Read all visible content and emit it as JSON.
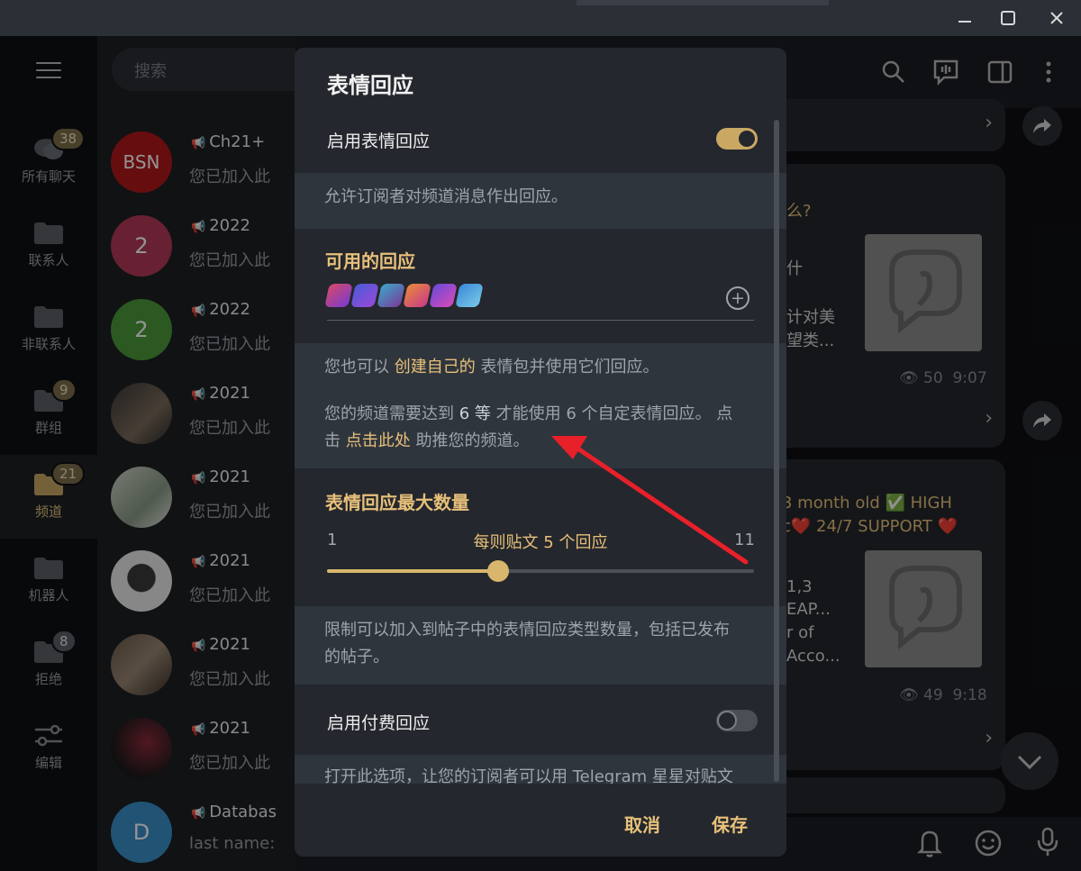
{
  "window": {
    "minimize": "—",
    "maximize": "☐",
    "close": "✕"
  },
  "rail": {
    "items": [
      {
        "label": "所有聊天",
        "badge": "38",
        "icon": "chats-icon"
      },
      {
        "label": "联系人",
        "badge": "",
        "icon": "folder-icon"
      },
      {
        "label": "非联系人",
        "badge": "",
        "icon": "folder-icon"
      },
      {
        "label": "群组",
        "badge": "9",
        "icon": "folder-icon"
      },
      {
        "label": "频道",
        "badge": "21",
        "icon": "folder-icon",
        "active": true
      },
      {
        "label": "机器人",
        "badge": "",
        "icon": "folder-icon"
      },
      {
        "label": "拒绝",
        "badge": "8",
        "icon": "folder-icon"
      },
      {
        "label": "编辑",
        "badge": "",
        "icon": "sliders-icon"
      }
    ]
  },
  "chatlist": {
    "search_placeholder": "搜索",
    "chats": [
      {
        "avatar": "BSN",
        "name": "Ch21+",
        "preview": "您已加入此"
      },
      {
        "avatar": "2",
        "name": "2022",
        "preview": "您已加入此"
      },
      {
        "avatar": "2",
        "name": "2022",
        "preview": "您已加入此"
      },
      {
        "avatar": "",
        "name": "2021",
        "preview": "您已加入此"
      },
      {
        "avatar": "",
        "name": "2021",
        "preview": "您已加入此"
      },
      {
        "avatar": "",
        "name": "2021",
        "preview": "您已加入此"
      },
      {
        "avatar": "",
        "name": "2021",
        "preview": "您已加入此"
      },
      {
        "avatar": "",
        "name": "2021",
        "preview": "您已加入此"
      },
      {
        "avatar": "D",
        "name": "Databas",
        "preview": "last name:"
      }
    ]
  },
  "messages": {
    "m1_fragment": "么?",
    "m1_line1": "什",
    "m1_line2": "计对美",
    "m1_line3": "望类...",
    "m1_views": "50",
    "m1_time": "9:07",
    "m2_line1": "3 month old ✅ HIGH",
    "m2_line2": "c❤️ 24/7 SUPPORT ❤️",
    "m2_line3": "1,3",
    "m2_line4": "EAP...",
    "m2_line5": "r of",
    "m2_line6": "Acco...",
    "m2_views": "49",
    "m2_time": "9:18"
  },
  "modal": {
    "title": "表情回应",
    "enable_label": "启用表情回应",
    "enable_desc": "允许订阅者对频道消息作出回应。",
    "available_title": "可用的回应",
    "custom_pre": "您也可以",
    "custom_link": "创建自己的",
    "custom_post": "表情包并使用它们回应。",
    "level_line1": "您的频道需要达到",
    "level_num": "6 等",
    "level_line1b": "才能使用 6 个自定表情回应。 点",
    "level_line2a": "击",
    "level_link": "点击此处",
    "level_line2b": "助推您的频道。",
    "max_title": "表情回应最大数量",
    "slider_min": "1",
    "slider_max": "11",
    "slider_value_label": "每则贴文 5 个回应",
    "slider_value": 5,
    "max_desc_line1": "限制可以加入到帖子中的表情回应类型数量，包括已发布",
    "max_desc_line2": "的帖子。",
    "paid_label": "启用付费回应",
    "paid_desc": "打开此选项，让您的订阅者可以用 Telegram 星星对贴文",
    "cancel": "取消",
    "save": "保存"
  },
  "colors": {
    "accent": "#e7c07a",
    "toggle_on": "#c9a864",
    "arrow": "#e8202a"
  }
}
